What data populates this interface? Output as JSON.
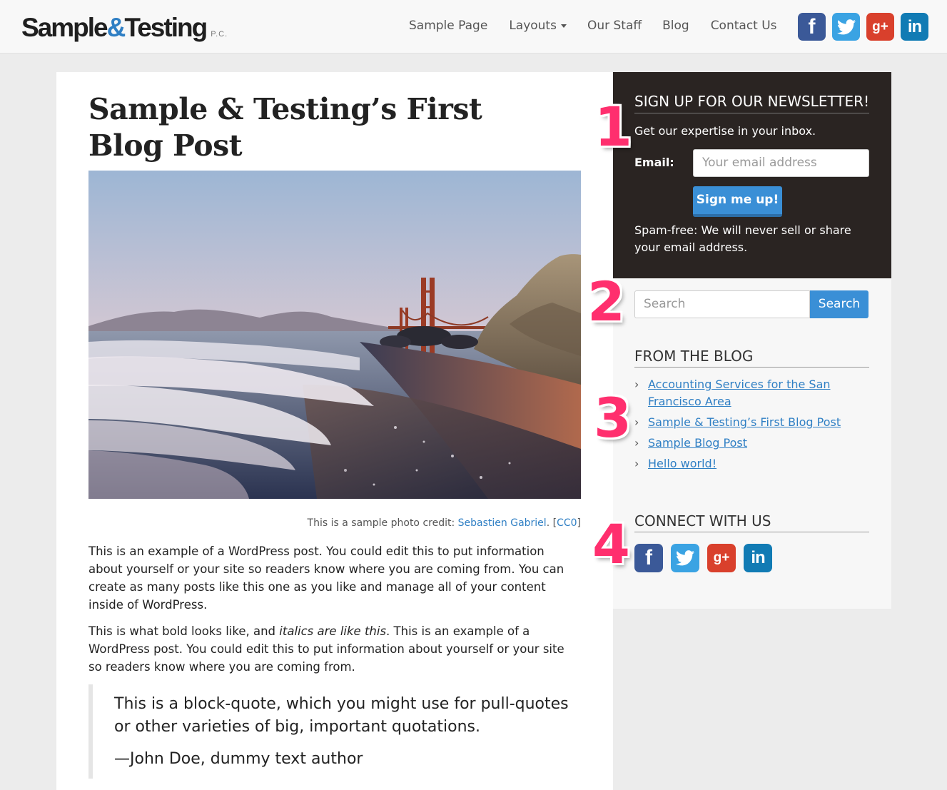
{
  "header": {
    "logo_main": "Sample",
    "logo_amp": "&",
    "logo_second": "Testing",
    "logo_suffix": "P.C.",
    "nav": [
      {
        "label": "Sample Page"
      },
      {
        "label": "Layouts"
      },
      {
        "label": "Our Staff"
      },
      {
        "label": "Blog"
      },
      {
        "label": "Contact Us"
      }
    ],
    "social": [
      {
        "icon": "facebook-icon",
        "glyph": "f",
        "color": "#3b5998"
      },
      {
        "icon": "twitter-icon",
        "glyph": "",
        "color": "#3aa3e3"
      },
      {
        "icon": "google-plus-icon",
        "glyph": "g+",
        "color": "#d9402c"
      },
      {
        "icon": "linkedin-icon",
        "glyph": "in",
        "color": "#117bb4"
      }
    ]
  },
  "post": {
    "title": "Sample & Testing’s First Blog Post",
    "caption_prefix": "This is a sample photo credit: ",
    "caption_author": "Sebastien Gabriel",
    "caption_mid": ". [",
    "caption_license": "CC0",
    "caption_end": "]",
    "para1": "This is an example of a WordPress post. You could edit this to put information about yourself or your site so readers know where you are coming from. You can create as many posts like this one as you like and manage all of your content inside of WordPress.",
    "para2_start": "This is what bold looks like, and ",
    "para2_italic": "italics are like this",
    "para2_end": ". This is an example of a WordPress post. You could edit this to put information about yourself or your site so readers know where you are coming from.",
    "quote_text": "This is a block-quote, which you might use for pull-quotes or other varieties of big, important quotations.",
    "quote_author": "—John Doe, dummy text author"
  },
  "sidebar": {
    "newsletter": {
      "title": "SIGN UP FOR OUR NEWSLETTER!",
      "subtitle": "Get our expertise in your inbox.",
      "email_label": "Email:",
      "email_placeholder": "Your email address",
      "button": "Sign me up!",
      "note": "Spam-free: We will never sell or share your email address."
    },
    "search": {
      "placeholder": "Search",
      "button": "Search"
    },
    "blog": {
      "title": "FROM THE BLOG",
      "items": [
        {
          "label": "Accounting Services for the San Francisco Area"
        },
        {
          "label": "Sample & Testing’s First Blog Post"
        },
        {
          "label": "Sample Blog Post"
        },
        {
          "label": "Hello world!"
        }
      ]
    },
    "connect": {
      "title": "CONNECT WITH US"
    }
  },
  "annotations": [
    "1",
    "2",
    "3",
    "4"
  ],
  "colors": {
    "accent": "#2f7fc4",
    "button": "#3a8fd6",
    "newsletter_bg": "#2a2422",
    "annotation": "#ff2f6e"
  }
}
